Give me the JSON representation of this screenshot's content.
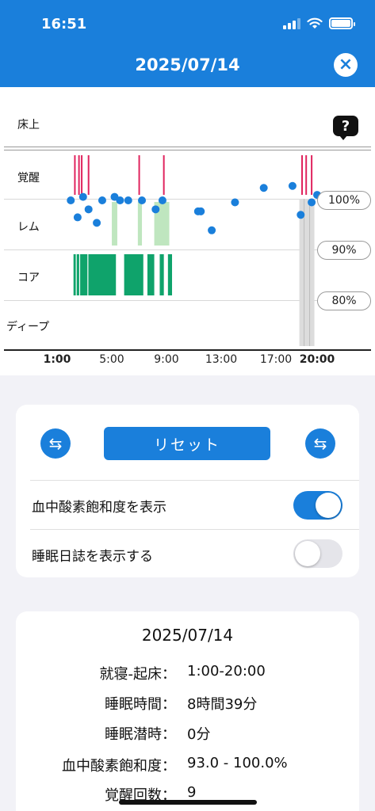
{
  "status_bar": {
    "time": "16:51"
  },
  "header": {
    "title": "2025/07/14",
    "close_icon": "×"
  },
  "chart": {
    "stage_labels": {
      "bed": "床上",
      "awake": "覚醒",
      "rem": "レム",
      "core": "コア",
      "deep": "ディープ"
    },
    "help_icon": "?",
    "spo2_axis": [
      "100%",
      "90%",
      "80%"
    ],
    "x_ticks": [
      "1:00",
      "5:00",
      "9:00",
      "13:00",
      "17:00",
      "20:00"
    ]
  },
  "chart_data": {
    "type": "scatter",
    "x_ticks": [
      "1:00",
      "5:00",
      "9:00",
      "13:00",
      "17:00",
      "20:00"
    ],
    "x_range_hours": [
      1,
      20
    ],
    "y_range_spo2_percent": [
      80,
      100
    ],
    "y_ticks": [
      "100%",
      "90%",
      "80%"
    ],
    "stage_rows": [
      "床上",
      "覚醒",
      "レム",
      "コア",
      "ディープ"
    ],
    "spo2_points": [
      {
        "t": 2.0,
        "v": 100.0
      },
      {
        "t": 2.5,
        "v": 96.6
      },
      {
        "t": 2.9,
        "v": 100.7
      },
      {
        "t": 3.3,
        "v": 98.2
      },
      {
        "t": 3.9,
        "v": 95.5
      },
      {
        "t": 4.3,
        "v": 100.0
      },
      {
        "t": 5.2,
        "v": 100.7
      },
      {
        "t": 5.6,
        "v": 100.0
      },
      {
        "t": 6.2,
        "v": 100.0
      },
      {
        "t": 7.2,
        "v": 100.0
      },
      {
        "t": 8.2,
        "v": 98.2
      },
      {
        "t": 8.7,
        "v": 100.0
      },
      {
        "t": 11.3,
        "v": 97.8
      },
      {
        "t": 11.5,
        "v": 97.8
      },
      {
        "t": 12.3,
        "v": 94.0
      },
      {
        "t": 14.0,
        "v": 99.6
      },
      {
        "t": 16.1,
        "v": 102.5
      },
      {
        "t": 18.2,
        "v": 102.9
      },
      {
        "t": 18.8,
        "v": 97.1
      },
      {
        "t": 19.6,
        "v": 99.6
      },
      {
        "t": 20.0,
        "v": 101.1
      }
    ],
    "awake_marks_hours": [
      2.3,
      2.6,
      2.8,
      3.3,
      7.0,
      8.8,
      18.9,
      19.2,
      19.6
    ],
    "rem_periods_hours": [
      [
        5.0,
        5.4
      ],
      [
        6.9,
        7.2
      ],
      [
        8.1,
        9.2
      ]
    ],
    "core_periods_hours": [
      [
        2.2,
        5.3
      ],
      [
        5.9,
        7.3
      ],
      [
        7.6,
        8.1
      ],
      [
        8.5,
        8.8
      ],
      [
        9.1,
        9.4
      ]
    ],
    "highlight_window_hours": [
      18.7,
      19.8
    ]
  },
  "controls": {
    "prev_icon": "⇆",
    "next_icon": "⇆",
    "reset_label": "リセット",
    "toggles": [
      {
        "label": "血中酸素飽和度を表示",
        "on": true
      },
      {
        "label": "睡眠日誌を表示する",
        "on": false
      }
    ]
  },
  "summary": {
    "date": "2025/07/14",
    "rows": [
      {
        "label": "就寝-起床：",
        "value": "1:00-20:00"
      },
      {
        "label": "睡眠時間：",
        "value": "8時間39分"
      },
      {
        "label": "睡眠潜時：",
        "value": "0分"
      },
      {
        "label": "血中酸素飽和度：",
        "value": "93.0 - 100.0%"
      },
      {
        "label": "覚醒回数：",
        "value": "9"
      }
    ]
  },
  "colors": {
    "accent": "#1a7fdb",
    "awake": "#e0245e",
    "core": "#0fa36b",
    "rem": "#bfe6bf",
    "spo2": "#1a7fdb"
  }
}
